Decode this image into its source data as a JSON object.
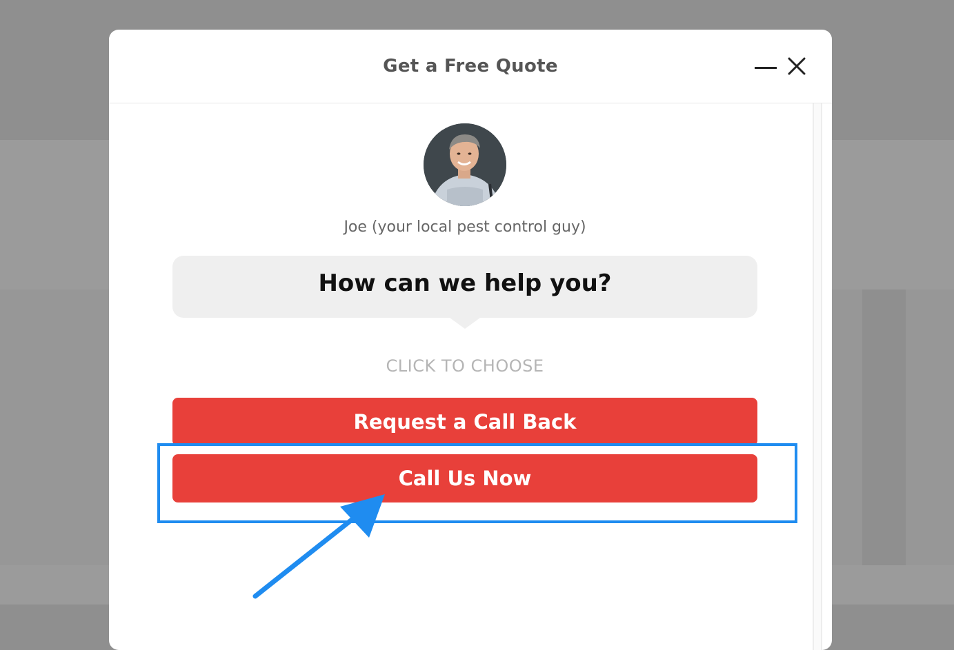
{
  "modal": {
    "title": "Get a Free Quote",
    "minimize_icon": "minimize-icon",
    "close_icon": "close-icon"
  },
  "agent": {
    "name": "Joe (your local pest control guy)",
    "avatar_icon": "avatar-photo"
  },
  "bubble": {
    "message": "How can we help you?"
  },
  "choose_label": "CLICK TO CHOOSE",
  "buttons": {
    "request_callback": "Request a Call Back",
    "call_now": "Call Us Now"
  },
  "colors": {
    "button": "#e8403a",
    "highlight": "#1f8cf0",
    "overlay": "#8f8f8f"
  }
}
